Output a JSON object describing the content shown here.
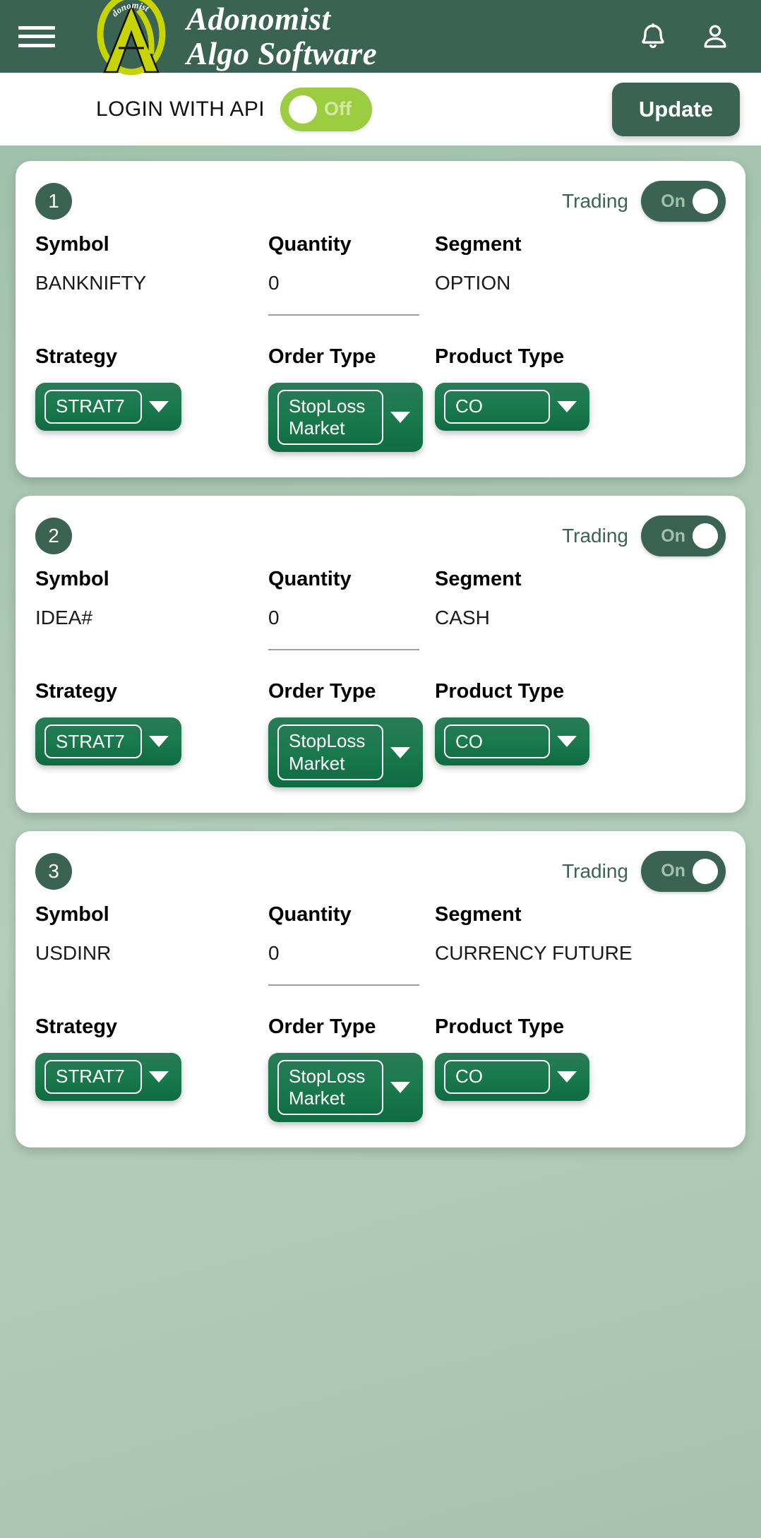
{
  "header": {
    "menu_icon": "hamburger-menu-icon",
    "brand_line1": "Adonomist",
    "brand_line2": "Algo Software",
    "logo_arc_text": "donomist",
    "notification_icon": "bell-icon",
    "account_icon": "person-icon"
  },
  "api_bar": {
    "label": "LOGIN WITH API",
    "toggle_state": "Off",
    "update_label": "Update"
  },
  "labels": {
    "symbol": "Symbol",
    "quantity": "Quantity",
    "segment": "Segment",
    "strategy": "Strategy",
    "order_type": "Order Type",
    "product_type": "Product Type",
    "trading": "Trading"
  },
  "colors": {
    "app_bar_green": "#3a6354",
    "logo_yellow": "#c8d400",
    "toggle_off_green": "#9ccc3f",
    "select_green": "#1b7a4e",
    "page_background": "#a9c6b2",
    "card_white": "#ffffff",
    "toggle_on_label": "#a3c0ad"
  },
  "cards": [
    {
      "number": "1",
      "trading_label": "Trading",
      "trading_state": "On",
      "symbol": "BANKNIFTY",
      "quantity": "0",
      "segment": "OPTION",
      "strategy": "STRAT7",
      "order_type": "StopLoss Market",
      "product_type": "CO"
    },
    {
      "number": "2",
      "trading_label": "Trading",
      "trading_state": "On",
      "symbol": "IDEA#",
      "quantity": "0",
      "segment": "CASH",
      "strategy": "STRAT7",
      "order_type": "StopLoss Market",
      "product_type": "CO"
    },
    {
      "number": "3",
      "trading_label": "Trading",
      "trading_state": "On",
      "symbol": "USDINR",
      "quantity": "0",
      "segment": "CURRENCY FUTURE",
      "strategy": "STRAT7",
      "order_type": "StopLoss Market",
      "product_type": "CO"
    }
  ]
}
